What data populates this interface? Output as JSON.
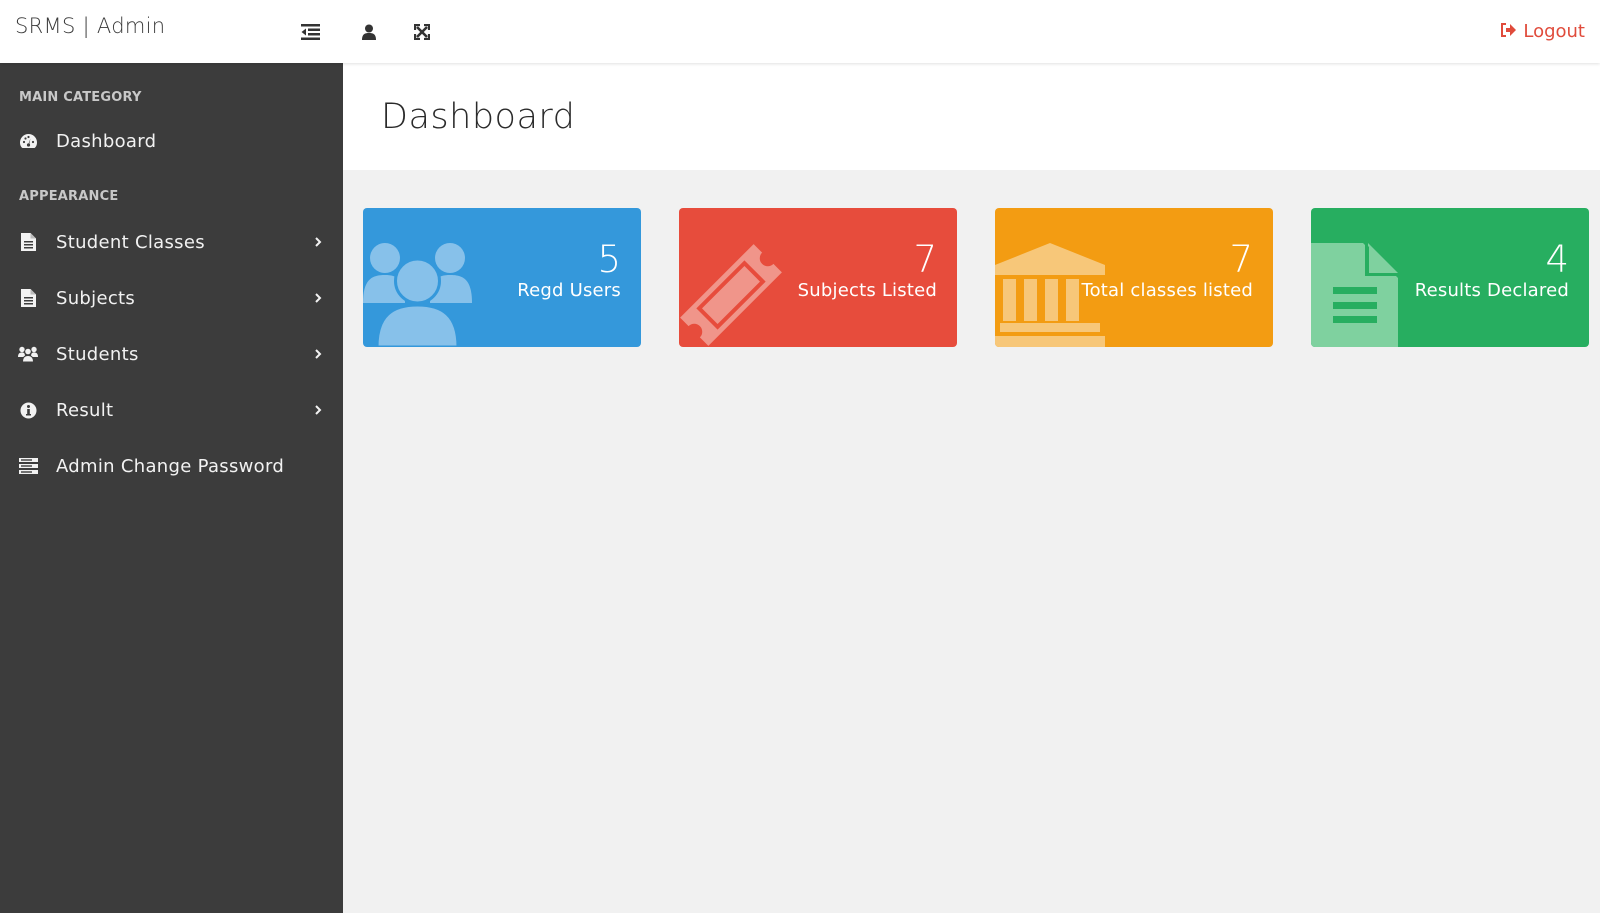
{
  "topbar": {
    "brand": "SRMS | Admin",
    "icons": [
      "menu-toggle-icon",
      "user-icon",
      "fullscreen-icon"
    ],
    "logout_label": "Logout",
    "logout_color": "#e04b3b"
  },
  "sidebar": {
    "sections": [
      {
        "label": "MAIN CATEGORY",
        "items": [
          {
            "label": "Dashboard",
            "icon": "dashboard-icon",
            "has_submenu": false
          }
        ]
      },
      {
        "label": "APPEARANCE",
        "items": [
          {
            "label": "Student Classes",
            "icon": "file-icon",
            "has_submenu": true
          },
          {
            "label": "Subjects",
            "icon": "file-icon",
            "has_submenu": true
          },
          {
            "label": "Students",
            "icon": "users-icon",
            "has_submenu": true
          },
          {
            "label": "Result",
            "icon": "info-icon",
            "has_submenu": true
          },
          {
            "label": "Admin Change Password",
            "icon": "server-icon",
            "has_submenu": false
          }
        ]
      }
    ]
  },
  "main": {
    "title": "Dashboard",
    "cards": [
      {
        "value": "5",
        "caption": "Regd Users",
        "icon": "users-icon",
        "color": "#3498db"
      },
      {
        "value": "7",
        "caption": "Subjects Listed",
        "icon": "ticket-icon",
        "color": "#e74c3c"
      },
      {
        "value": "7",
        "caption": "Total classes listed",
        "icon": "bank-icon",
        "color": "#f39c12"
      },
      {
        "value": "4",
        "caption": "Results Declared",
        "icon": "file-text-icon",
        "color": "#27ae60"
      }
    ]
  }
}
